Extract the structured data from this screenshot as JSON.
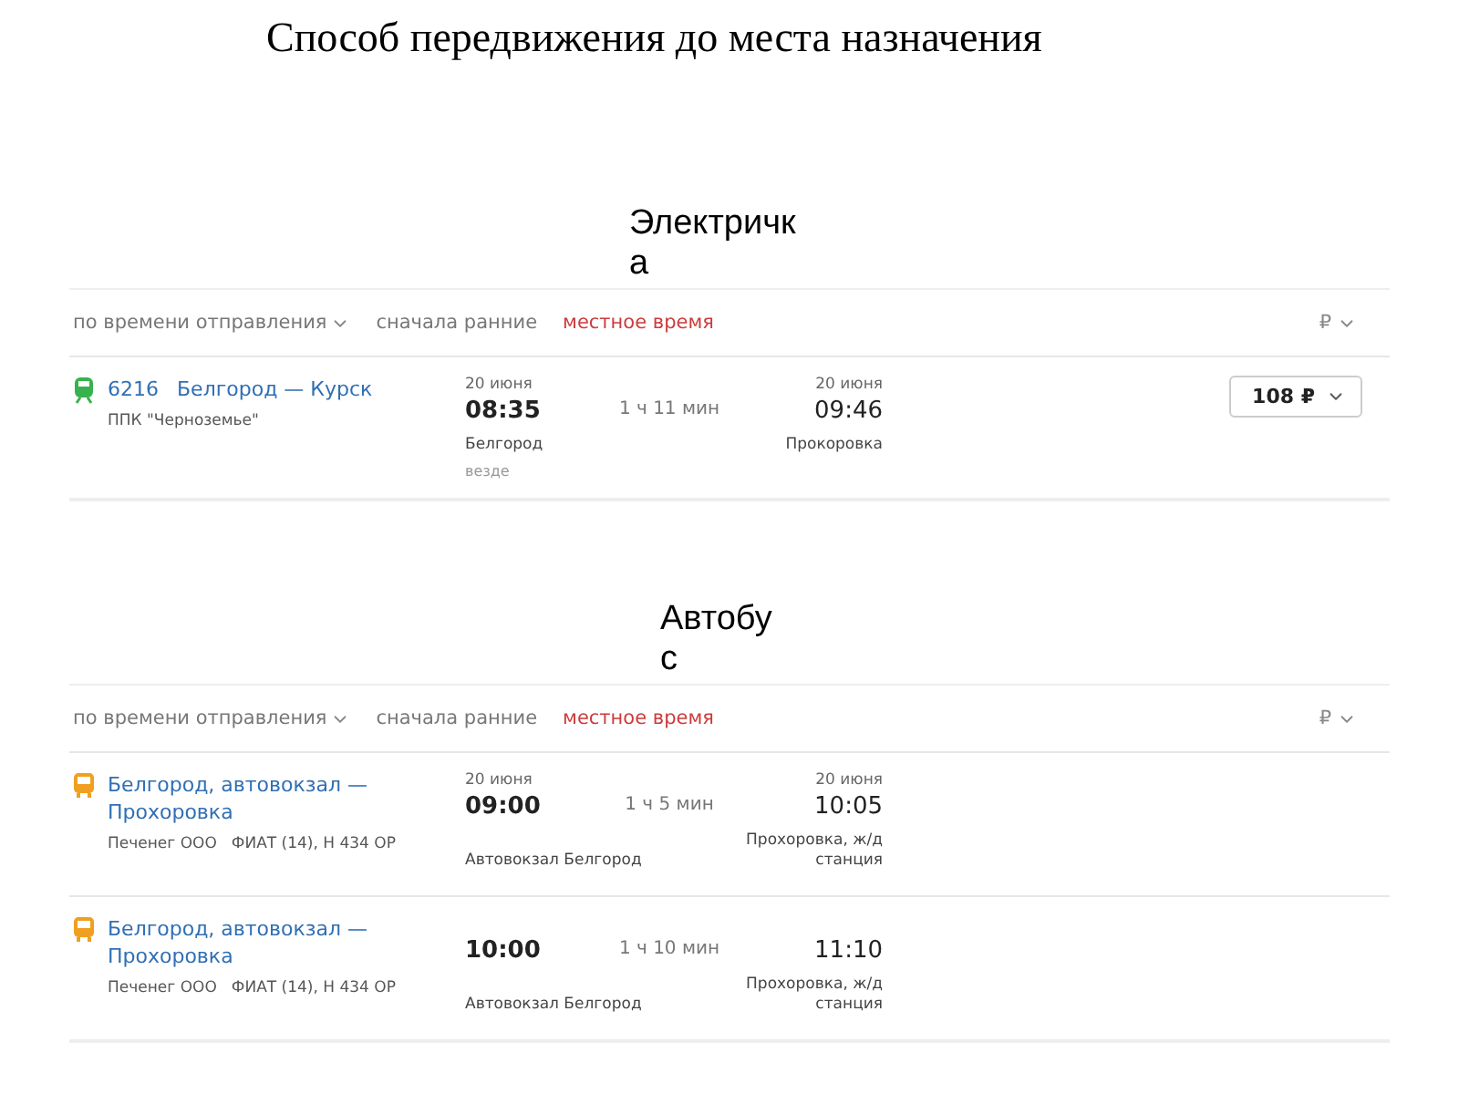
{
  "title": "Способ передвижения до места назначения",
  "sections": [
    {
      "label": "Электричка",
      "sort": {
        "field": "по времени отправления",
        "order": "сначала ранние",
        "time_note": "местное время",
        "currency": "₽"
      },
      "trips": [
        {
          "kind": "train",
          "number": "6216",
          "route": "Белгород — Курск",
          "carrier": "ППК \"Черноземье\"",
          "depart_date": "20 июня",
          "depart_time": "08:35",
          "depart_place": "Белгород",
          "depart_note": "везде",
          "duration": "1 ч 11 мин",
          "arrive_date": "20 июня",
          "arrive_time": "09:46",
          "arrive_place": "Прокоровка",
          "price": "108 ₽"
        }
      ]
    },
    {
      "label": "Автобус",
      "sort": {
        "field": "по времени отправления",
        "order": "сначала ранние",
        "time_note": "местное время",
        "currency": "₽"
      },
      "trips": [
        {
          "kind": "bus",
          "route": "Белгород, автовокзал — Прохоровка",
          "carrier": "Печенег ООО",
          "vehicle": "ФИАТ (14), Н 434 ОР",
          "depart_date": "20 июня",
          "depart_time": "09:00",
          "depart_place": "Автовокзал Белгород",
          "duration": "1 ч 5 мин",
          "arrive_date": "20 июня",
          "arrive_time": "10:05",
          "arrive_place": "Прохоровка, ж/д станция"
        },
        {
          "kind": "bus",
          "route": "Белгород, автовокзал — Прохоровка",
          "carrier": "Печенег ООО",
          "vehicle": "ФИАТ (14), Н 434 ОР",
          "depart_time": "10:00",
          "depart_place": "Автовокзал Белгород",
          "duration": "1 ч 10 мин",
          "arrive_time": "11:10",
          "arrive_place": "Прохоровка, ж/д станция"
        }
      ]
    }
  ]
}
